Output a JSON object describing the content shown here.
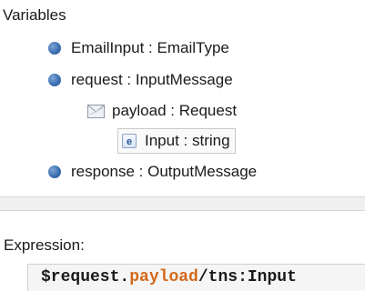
{
  "variables": {
    "title": "Variables",
    "items": [
      {
        "label": "EmailInput : EmailType",
        "icon": "variable-dot-icon"
      },
      {
        "label": "request : InputMessage",
        "icon": "variable-dot-icon"
      },
      {
        "label": "payload : Request",
        "icon": "message-part-icon"
      },
      {
        "label": "Input : string",
        "icon": "element-icon",
        "icon_letter": "e",
        "selected": true
      },
      {
        "label": "response : OutputMessage",
        "icon": "variable-dot-icon"
      }
    ]
  },
  "expression": {
    "title": "Expression:",
    "tokens": {
      "variable": "$request",
      "dot": ".",
      "part": "payload",
      "path": "/tns:Input"
    }
  },
  "colors": {
    "accent_field": "#d4691a",
    "variable_dot": "#3d6fb3"
  }
}
